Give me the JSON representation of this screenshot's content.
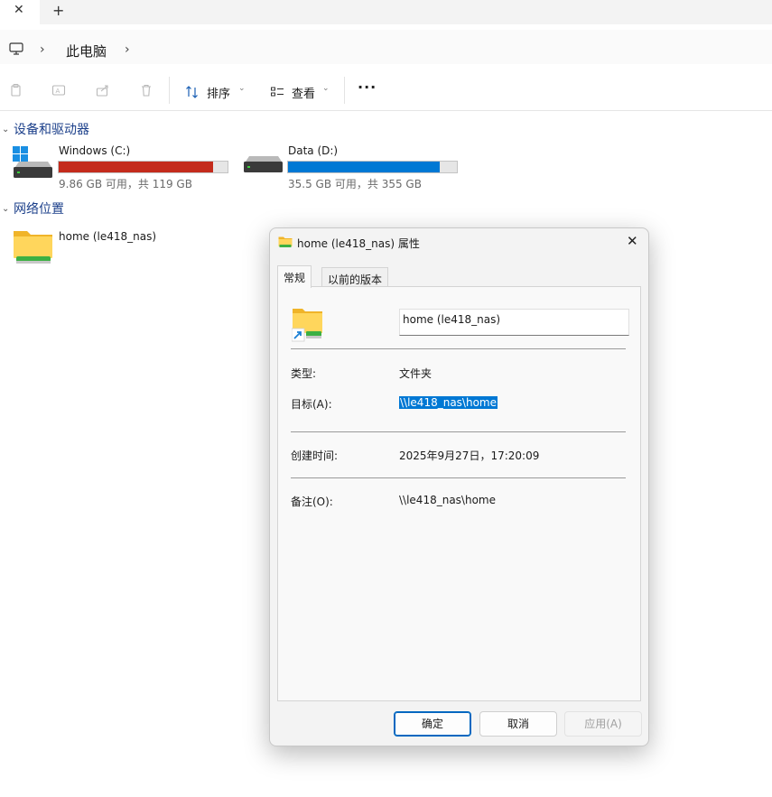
{
  "explorer": {
    "tabbar": {
      "close_glyph": "✕",
      "add_glyph": "+"
    },
    "address": {
      "chevron": "›",
      "crumb": "此电脑"
    },
    "toolbar": {
      "sort_label": "排序",
      "view_label": "查看",
      "more_glyph": "···",
      "caret": "⌄"
    },
    "sections": {
      "devices": {
        "title": "设备和驱动器"
      },
      "network": {
        "title": "网络位置"
      }
    },
    "drives": [
      {
        "name": "Windows (C:)",
        "info": "9.86 GB 可用，共 119 GB",
        "used_fraction": 0.917,
        "fill_color": "#c42b1c"
      },
      {
        "name": "Data (D:)",
        "info": "35.5 GB 可用，共 355 GB",
        "used_fraction": 0.9,
        "fill_color": "#0078d4"
      }
    ],
    "network_items": [
      {
        "name": "home (le418_nas)"
      }
    ]
  },
  "dialog": {
    "title": "home (le418_nas) 属性",
    "close_glyph": "✕",
    "tabs": [
      "常规",
      "以前的版本"
    ],
    "name_value": "home (le418_nas)",
    "props": {
      "type_label": "类型:",
      "type_value": "文件夹",
      "target_label": "目标(A):",
      "target_value": "\\\\le418_nas\\home",
      "created_label": "创建时间:",
      "created_value": "2025年9月27日，17:20:09",
      "comment_label": "备注(O):",
      "comment_value": "\\\\le418_nas\\home"
    },
    "buttons": {
      "ok": "确定",
      "cancel": "取消",
      "apply": "应用(A)"
    }
  },
  "colors": {
    "accent": "#0078d4",
    "section_title": "#1b3f8a",
    "drive_c_fill": "#c42b1c",
    "drive_d_fill": "#0078d4"
  }
}
